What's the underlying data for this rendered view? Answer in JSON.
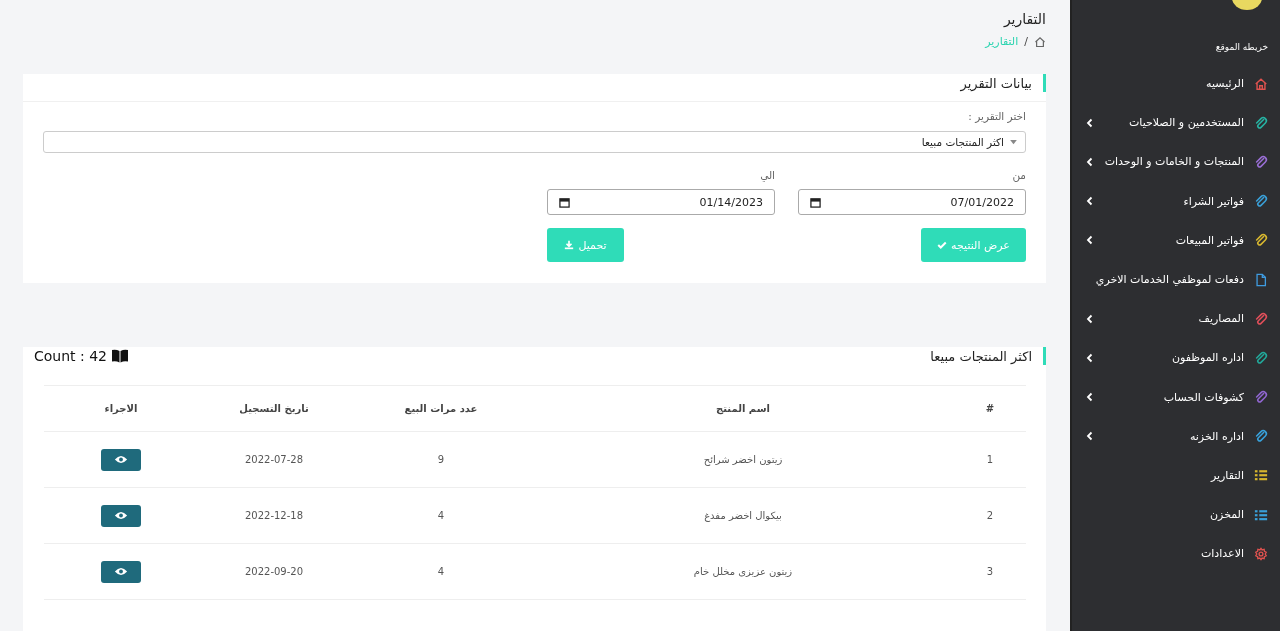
{
  "page": {
    "title": "التقارير",
    "breadcrumb_separator": "/",
    "breadcrumb": [
      "التقارير"
    ]
  },
  "sidebar": {
    "heading": "خريطه الموقع",
    "items": [
      {
        "label": "الرئيسيه",
        "kind": "home",
        "color": "#e0524f",
        "expandable": false
      },
      {
        "label": "المستخدمين و الصلاحيات",
        "kind": "clip",
        "color": "#26b3a3",
        "expandable": true
      },
      {
        "label": "المنتجات و الخامات و الوحدات",
        "kind": "clip",
        "color": "#9a6fd6",
        "expandable": true
      },
      {
        "label": "فواتير الشراء",
        "kind": "clip",
        "color": "#3aa0d8",
        "expandable": true
      },
      {
        "label": "فواتير المبيعات",
        "kind": "clip",
        "color": "#d8b830",
        "expandable": true
      },
      {
        "label": "دفعات لموظفي الخدمات الاخري",
        "kind": "file",
        "color": "#3f9be0",
        "expandable": false
      },
      {
        "label": "المصاريف",
        "kind": "clip",
        "color": "#e04f5a",
        "expandable": true
      },
      {
        "label": "اداره الموظفون",
        "kind": "clip",
        "color": "#22a89a",
        "expandable": true
      },
      {
        "label": "كشوفات الحساب",
        "kind": "clip",
        "color": "#9066d0",
        "expandable": true
      },
      {
        "label": "اداره الخزنه",
        "kind": "clip",
        "color": "#38a2dc",
        "expandable": true
      },
      {
        "label": "التقارير",
        "kind": "list",
        "color": "#d6b52e",
        "expandable": false
      },
      {
        "label": "المخزن",
        "kind": "list",
        "color": "#3a9fd8",
        "expandable": false
      },
      {
        "label": "الاعدادات",
        "kind": "gear",
        "color": "#e0524f",
        "expandable": false
      }
    ]
  },
  "report_form": {
    "title": "بيانات التقرير",
    "select_label": "اختر التقرير :",
    "select_value": "اكثر المنتجات مبيعا",
    "from_label": "من",
    "from_value": "07/01/2022",
    "to_label": "الي",
    "to_value": "01/14/2023",
    "show_button": "عرض النتيجه",
    "download_button": "تحميل"
  },
  "results": {
    "title": "اكثر المنتجات مبيعا",
    "count": "Count : 42",
    "columns": [
      "#",
      "اسم المنتج",
      "عدد مرات البيع",
      "تاريخ التسجيل",
      "الاجراء"
    ],
    "rows": [
      {
        "index": "1",
        "product": "زيتون اخضر شرائح",
        "sales": "9",
        "date": "2022-07-28"
      },
      {
        "index": "2",
        "product": "بيكوال اخضر مفدغ",
        "sales": "4",
        "date": "2022-12-18"
      },
      {
        "index": "3",
        "product": "زيتون عزيزى مخلل خام",
        "sales": "4",
        "date": "2022-09-20"
      }
    ]
  }
}
